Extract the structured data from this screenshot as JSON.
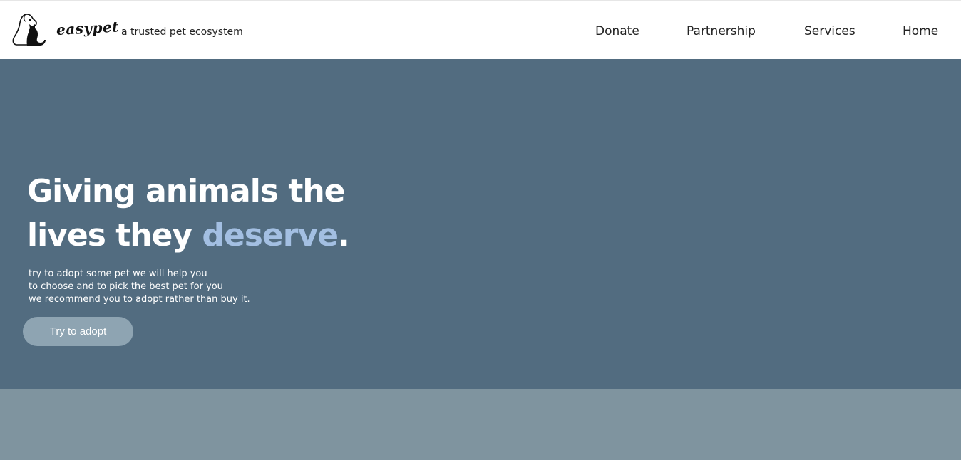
{
  "header": {
    "brand": "easypet",
    "tagline": "a trusted pet ecosystem",
    "logo_icon": "dog-and-cat-silhouette-icon",
    "nav": {
      "donate": "Donate",
      "partnership": "Partnership",
      "services": "Services",
      "home": "Home"
    }
  },
  "hero": {
    "heading_line1": "Giving animals the",
    "heading_line2_start": "lives they ",
    "heading_accent": "deserve",
    "heading_end": ".",
    "sub_lines": [
      "try to adopt some pet we will help you",
      "to choose and to pick the best pet for you",
      "we recommend you to adopt rather than buy it."
    ],
    "cta_label": "Try to adopt"
  },
  "colors": {
    "hero_bg": "#526c80",
    "accent": "#a3bfe2",
    "cta_bg": "#8ea4b2",
    "band_bg": "#7f949f"
  }
}
